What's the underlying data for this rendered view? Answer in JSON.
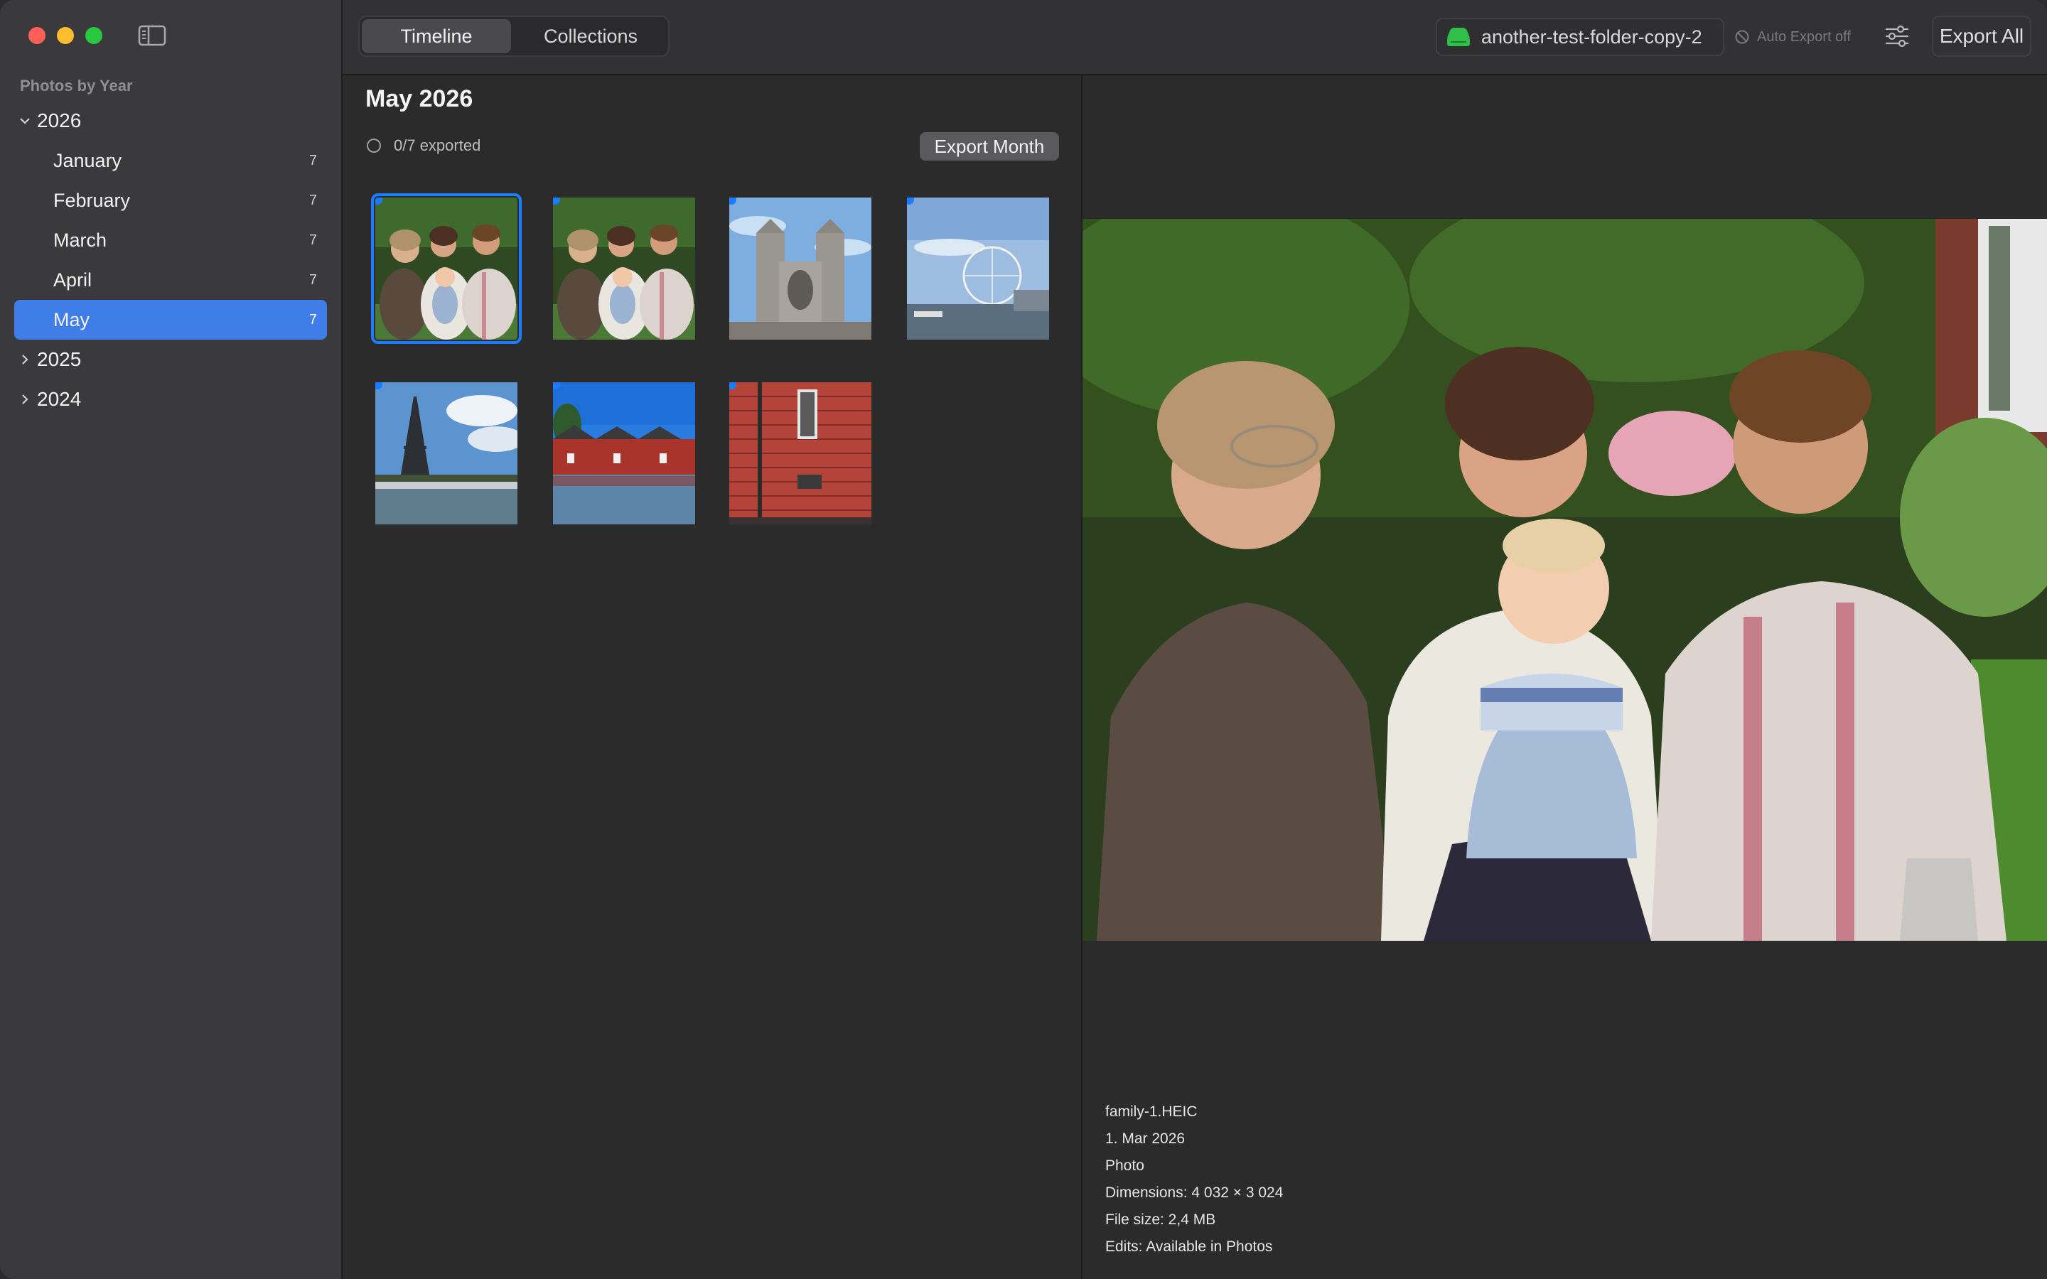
{
  "window": {
    "controls": [
      "close",
      "minimize",
      "zoom"
    ]
  },
  "sidebar": {
    "section_title": "Photos by Year",
    "years": [
      {
        "label": "2026",
        "expanded": true,
        "months": [
          {
            "label": "January",
            "count": "7"
          },
          {
            "label": "February",
            "count": "7"
          },
          {
            "label": "March",
            "count": "7"
          },
          {
            "label": "April",
            "count": "7"
          },
          {
            "label": "May",
            "count": "7",
            "selected": true
          }
        ]
      },
      {
        "label": "2025",
        "expanded": false
      },
      {
        "label": "2024",
        "expanded": false
      }
    ]
  },
  "toolbar": {
    "tabs": [
      {
        "label": "Timeline",
        "active": true
      },
      {
        "label": "Collections",
        "active": false
      }
    ],
    "folder_name": "another-test-folder-copy-2",
    "auto_export": "Auto Export off",
    "export_all": "Export All"
  },
  "main": {
    "month_title": "May 2026",
    "export_status": "0/7 exported",
    "export_month": "Export Month",
    "photos": [
      {
        "subject": "family",
        "selected": true
      },
      {
        "subject": "family"
      },
      {
        "subject": "cathedral"
      },
      {
        "subject": "ferris-wheel"
      },
      {
        "subject": "eiffel-tower"
      },
      {
        "subject": "red-houses"
      },
      {
        "subject": "brick-wall"
      }
    ]
  },
  "preview": {
    "filename": "family-1.HEIC",
    "date": "1. Mar 2026",
    "kind": "Photo",
    "dimensions": "Dimensions: 4 032 × 3 024",
    "file_size": "File size: 2,4 MB",
    "edits": "Edits: Available in Photos"
  },
  "colors": {
    "accent": "#3f7ee8",
    "selection_outline": "#1a7cff",
    "sidebar_bg": "#3a3a3c",
    "content_bg": "#2b2b2b",
    "drive_icon": "#30c04a"
  }
}
